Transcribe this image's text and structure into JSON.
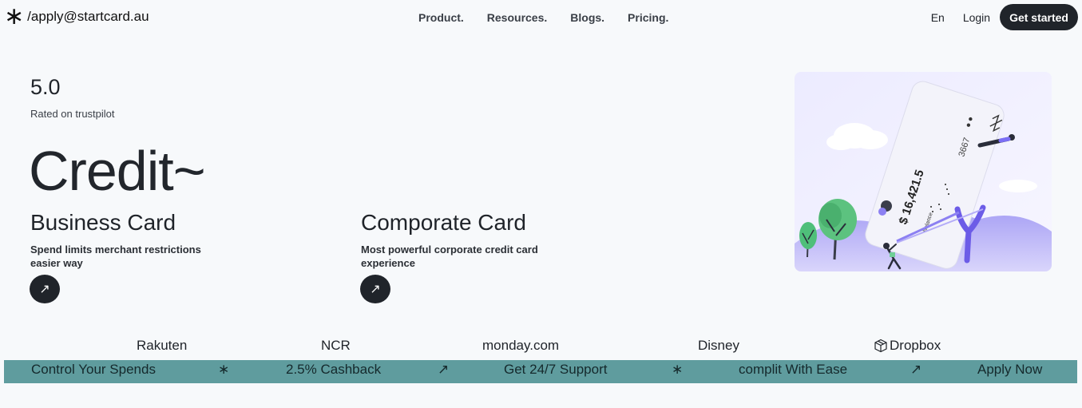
{
  "header": {
    "logo_symbol": "∗",
    "logo_text": "/apply@startcard.au",
    "nav": [
      "Product.",
      "Resources.",
      "Blogs.",
      "Pricing."
    ],
    "lang": "En",
    "login": "Login",
    "cta": "Get started"
  },
  "hero": {
    "rating": "5.0",
    "rating_sub": "Rated on trustpilot",
    "headline": "Credit~",
    "cards": [
      {
        "title": "Business Card",
        "desc": "Spend limits merchant restrictions easier way",
        "arrow": "↗"
      },
      {
        "title": "Comporate Card",
        "desc": "Most powerful corporate credit card experience",
        "arrow": "↗"
      }
    ]
  },
  "illustration": {
    "card_number": "3667",
    "balance_amount": "$ 16,421.5",
    "balance_label": "Balance"
  },
  "brands": [
    "Rakuten",
    "NCR",
    "monday.com",
    "Disney",
    "Dropbox"
  ],
  "ticker": [
    "Control Your Spends",
    "∗",
    "2.5% Cashback",
    "↗",
    "Get 24/7 Support",
    "∗",
    "complit With Ease",
    "↗",
    "Apply Now"
  ],
  "colors": {
    "background": "#f7f9fb",
    "dark": "#20242a",
    "ticker_bg": "#5f9c9e",
    "accent_purple": "#7b6ef6"
  }
}
